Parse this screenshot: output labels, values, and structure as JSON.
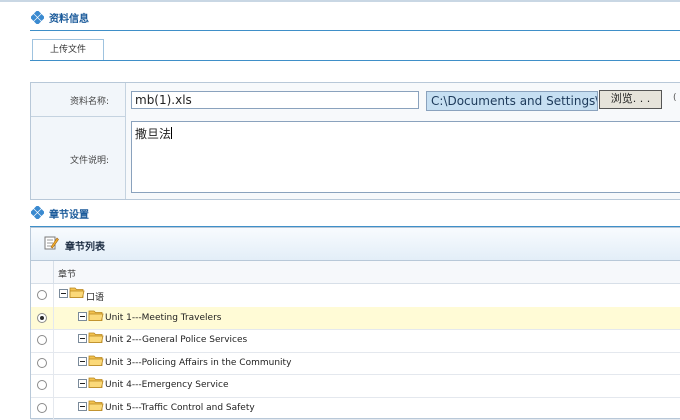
{
  "section_info": {
    "title": "资料信息"
  },
  "tabs": [
    {
      "label": "上传文件"
    }
  ],
  "form": {
    "name_label": "资料名称:",
    "name_value": "mb(1).xls",
    "path_value": "C:\\Documents and Settings\\a",
    "browse_label": "浏览. . .",
    "trailing_mark": "(",
    "desc_label": "文件说明:",
    "desc_value": "撒旦法"
  },
  "section_chapter": {
    "title": "章节设置"
  },
  "chapter_panel": {
    "title": "章节列表",
    "column_header": "章节",
    "rows": [
      {
        "label": "口语",
        "level": 0,
        "selected": false
      },
      {
        "label": "Unit 1---Meeting Travelers",
        "level": 1,
        "selected": true
      },
      {
        "label": "Unit 2---General Police Services",
        "level": 1,
        "selected": false
      },
      {
        "label": "Unit 3---Policing Affairs in the Community",
        "level": 1,
        "selected": false
      },
      {
        "label": "Unit 4---Emergency Service",
        "level": 1,
        "selected": false
      },
      {
        "label": "Unit 5---Traffic Control and Safety",
        "level": 1,
        "selected": false
      }
    ]
  },
  "colors": {
    "accent": "#1a5a9a",
    "selected_row": "#fffbd6",
    "path_box": "#c6dff2"
  }
}
